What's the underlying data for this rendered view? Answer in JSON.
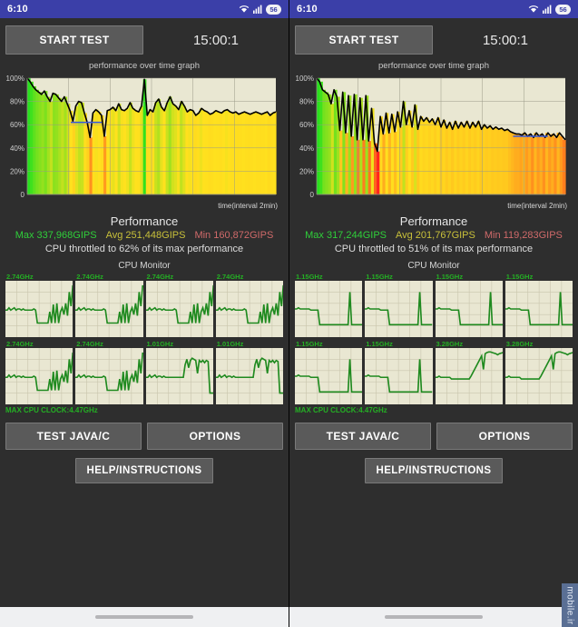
{
  "screens": [
    {
      "id": "left",
      "statusbar": {
        "clock": "6:10",
        "wifi_icon": "wifi-icon",
        "signal_icon": "cellular-signal-icon",
        "battery": "56"
      },
      "toolbar": {
        "start_label": "START TEST",
        "timer": "15:00:1"
      },
      "chart_data": {
        "type": "area",
        "title": "performance over time graph",
        "xlabel": "time(interval 2min)",
        "ylabel": "",
        "ylim": [
          0,
          100
        ],
        "yticks": [
          "100%",
          "80%",
          "60%",
          "40%",
          "20%",
          "0"
        ],
        "grid": true,
        "marker_line_pct": 62,
        "series": [
          {
            "name": "performance",
            "values": [
              100,
              97,
              93,
              90,
              88,
              86,
              89,
              84,
              80,
              87,
              86,
              83,
              80,
              84,
              78,
              72,
              63,
              76,
              80,
              79,
              70,
              62,
              49,
              70,
              73,
              71,
              68,
              50,
              72,
              73,
              75,
              72,
              78,
              73,
              72,
              74,
              79,
              74,
              72,
              71,
              76,
              99,
              68,
              73,
              71,
              79,
              82,
              75,
              72,
              79,
              84,
              78,
              76,
              73,
              80,
              76,
              71,
              73,
              72,
              68,
              70,
              74,
              72,
              71,
              69,
              70,
              72,
              71,
              70,
              72,
              73,
              71,
              70,
              71,
              69,
              70,
              71,
              70,
              69,
              70,
              71,
              70,
              69,
              70,
              71,
              68,
              70,
              71
            ]
          }
        ]
      },
      "performance": {
        "title": "Performance",
        "max": "Max 337,968GIPS",
        "avg": "Avg 251,448GIPS",
        "min": "Min 160,872GIPS",
        "note": "CPU throttled to 62% of its max performance"
      },
      "cpu_monitor": {
        "title": "CPU Monitor",
        "max_clock": "MAX CPU CLOCK:4.47GHz",
        "cores": [
          {
            "freq": "2.74GHz",
            "shape": "a"
          },
          {
            "freq": "2.74GHz",
            "shape": "a"
          },
          {
            "freq": "2.74GHz",
            "shape": "a"
          },
          {
            "freq": "2.74GHz",
            "shape": "a"
          },
          {
            "freq": "2.74GHz",
            "shape": "a"
          },
          {
            "freq": "2.74GHz",
            "shape": "a"
          },
          {
            "freq": "1.01GHz",
            "shape": "b"
          },
          {
            "freq": "1.01GHz",
            "shape": "b"
          }
        ]
      },
      "buttons": {
        "test": "TEST JAVA/C",
        "options": "OPTIONS",
        "help": "HELP/INSTRUCTIONS"
      }
    },
    {
      "id": "right",
      "statusbar": {
        "clock": "6:10",
        "wifi_icon": "wifi-icon",
        "signal_icon": "cellular-signal-icon",
        "battery": "56"
      },
      "toolbar": {
        "start_label": "START TEST",
        "timer": "15:00:1"
      },
      "chart_data": {
        "type": "area",
        "title": "performance over time graph",
        "xlabel": "time(interval 2min)",
        "ylabel": "",
        "ylim": [
          0,
          100
        ],
        "yticks": [
          "100%",
          "80%",
          "60%",
          "40%",
          "20%",
          "0"
        ],
        "grid": true,
        "marker_line_pct": 50,
        "series": [
          {
            "name": "performance",
            "values": [
              100,
              97,
              90,
              88,
              86,
              78,
              90,
              84,
              55,
              88,
              53,
              85,
              50,
              86,
              47,
              83,
              47,
              85,
              46,
              74,
              44,
              37,
              67,
              52,
              70,
              53,
              69,
              54,
              71,
              58,
              80,
              60,
              72,
              58,
              77,
              56,
              67,
              63,
              66,
              62,
              65,
              60,
              66,
              58,
              64,
              57,
              62,
              56,
              63,
              57,
              62,
              58,
              63,
              57,
              62,
              58,
              63,
              56,
              60,
              57,
              59,
              56,
              58,
              56,
              57,
              55,
              56,
              54,
              53,
              52,
              52,
              51,
              53,
              50,
              52,
              49,
              53,
              50,
              52,
              49,
              53,
              50,
              52,
              49,
              53,
              50,
              47
            ]
          }
        ]
      },
      "performance": {
        "title": "Performance",
        "max": "Max 317,244GIPS",
        "avg": "Avg 201,767GIPS",
        "min": "Min 119,283GIPS",
        "note": "CPU throttled to 51% of its max performance"
      },
      "cpu_monitor": {
        "title": "CPU Monitor",
        "max_clock": "MAX CPU CLOCK:4.47GHz",
        "cores": [
          {
            "freq": "1.15GHz",
            "shape": "c"
          },
          {
            "freq": "1.15GHz",
            "shape": "c"
          },
          {
            "freq": "1.15GHz",
            "shape": "c"
          },
          {
            "freq": "1.15GHz",
            "shape": "c"
          },
          {
            "freq": "1.15GHz",
            "shape": "c"
          },
          {
            "freq": "1.15GHz",
            "shape": "c"
          },
          {
            "freq": "3.28GHz",
            "shape": "d"
          },
          {
            "freq": "3.28GHz",
            "shape": "d"
          }
        ]
      },
      "buttons": {
        "test": "TEST JAVA/C",
        "options": "OPTIONS",
        "help": "HELP/INSTRUCTIONS"
      }
    }
  ],
  "watermark": {
    "text": "mobile.ir"
  },
  "colors": {
    "statusbar": "#3b3fa8",
    "app_bg": "#2e2e2e",
    "button": "#5a5a5a",
    "chart_bg": "#e9e7d2",
    "line": "#000000",
    "marker": "#3a5ad9",
    "cpu_line": "#1f8a1f",
    "max": "#2fcf3a",
    "avg": "#c8c03a",
    "min": "#d06a6a"
  }
}
